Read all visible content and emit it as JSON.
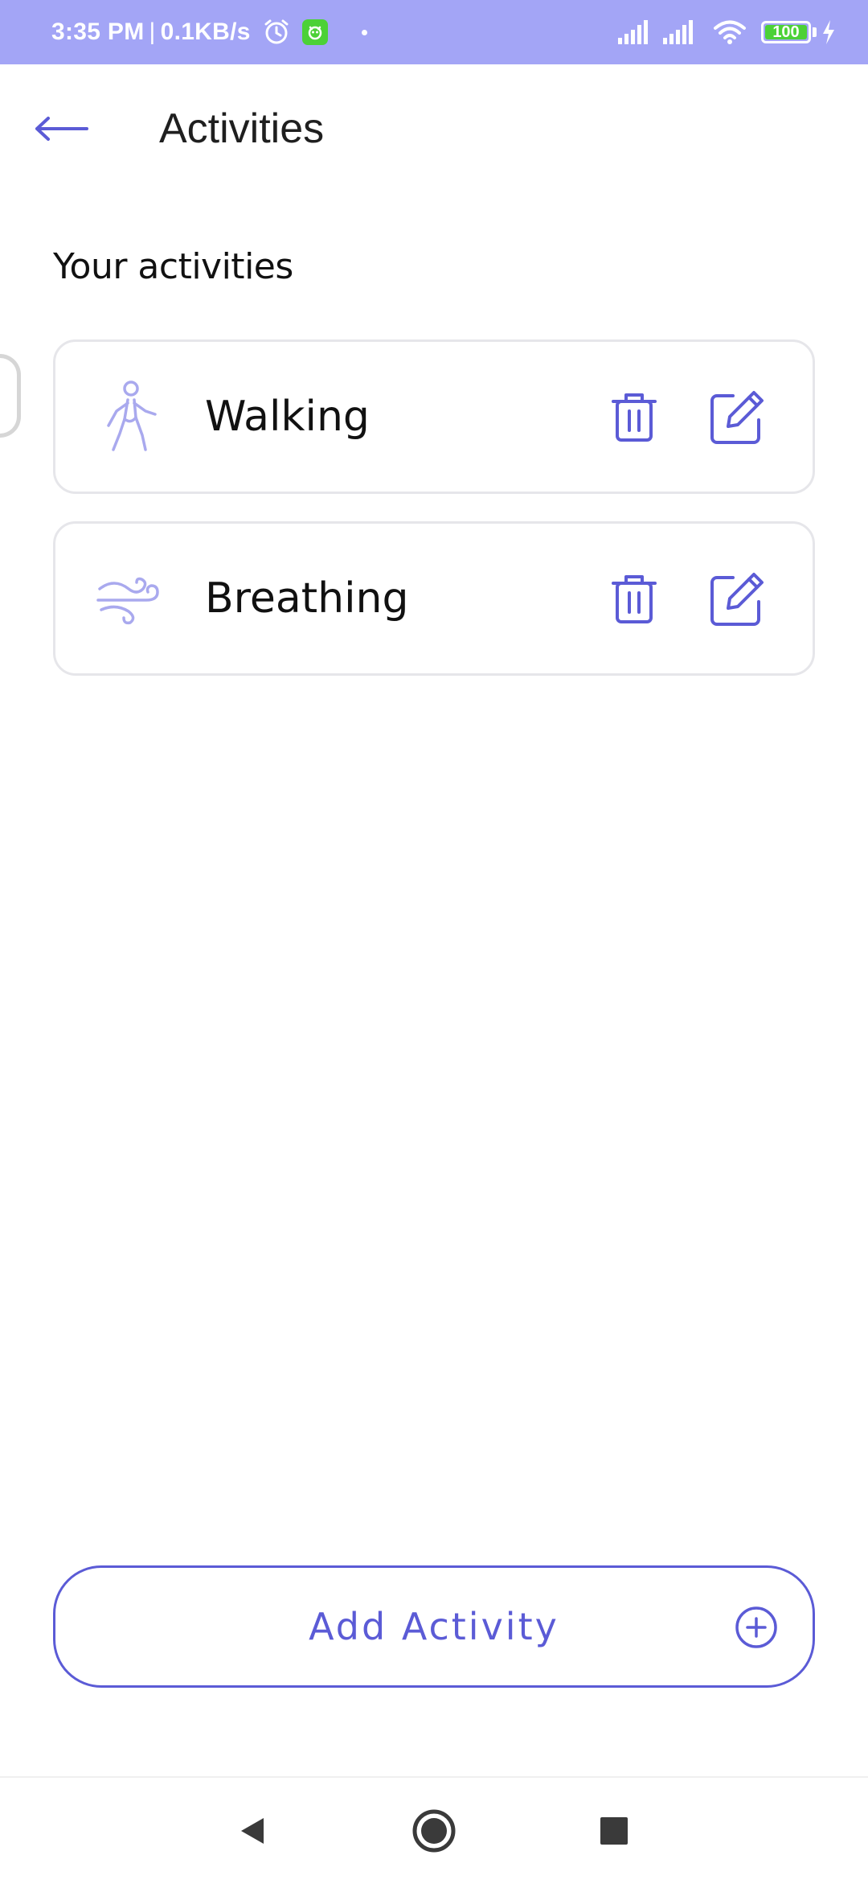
{
  "status_bar": {
    "time": "3:35 PM",
    "separator": "|",
    "net_speed": "0.1KB/s",
    "battery": "100",
    "icons": [
      "alarm-icon",
      "app-notification-icon",
      "signal-icon",
      "signal-icon",
      "wifi-icon",
      "battery-icon",
      "charging-icon"
    ],
    "background_color": "#a3a5f6",
    "battery_color": "#4cd137"
  },
  "header": {
    "title": "Activities",
    "back_icon": "arrow-left-icon"
  },
  "section": {
    "heading": "Your activities"
  },
  "activities": [
    {
      "label": "Walking",
      "icon": "walking-person-icon"
    },
    {
      "label": "Breathing",
      "icon": "wind-icon"
    }
  ],
  "actions": {
    "delete_icon": "trash-icon",
    "edit_icon": "edit-icon"
  },
  "add_button": {
    "label": "Add Activity",
    "icon": "plus-circle-icon"
  },
  "nav_bar": {
    "buttons": [
      "back-triangle-icon",
      "home-circle-icon",
      "recents-square-icon"
    ]
  },
  "colors": {
    "accent": "#5b5bd6",
    "icon_light": "#a9a9ee",
    "card_border": "#e6e6ea"
  }
}
